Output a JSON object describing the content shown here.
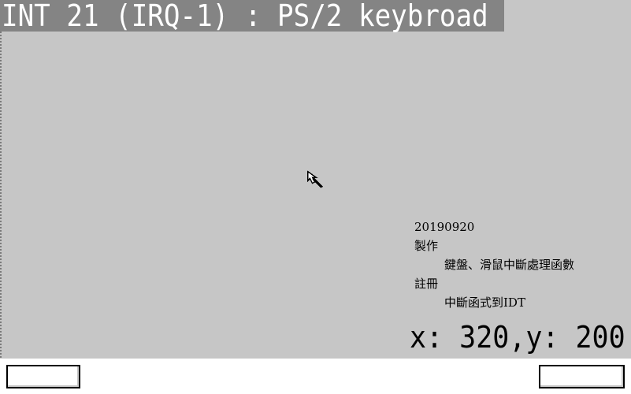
{
  "title": "INT 21 (IRQ-1) : PS/2 keybroad",
  "info": {
    "date": "20190920",
    "made_label": "製作",
    "made_value": "鍵盤、滑鼠中斷處理函數",
    "note_label": "註冊",
    "note_value": "中斷函式到IDT"
  },
  "coords": "x: 320,y: 200",
  "icons": {
    "cursor": "mouse-cursor-icon"
  },
  "colors": {
    "desktop": "#c6c6c6",
    "title_bar": "#848484",
    "title_text": "#ffffff",
    "taskbar": "#ffffff"
  }
}
